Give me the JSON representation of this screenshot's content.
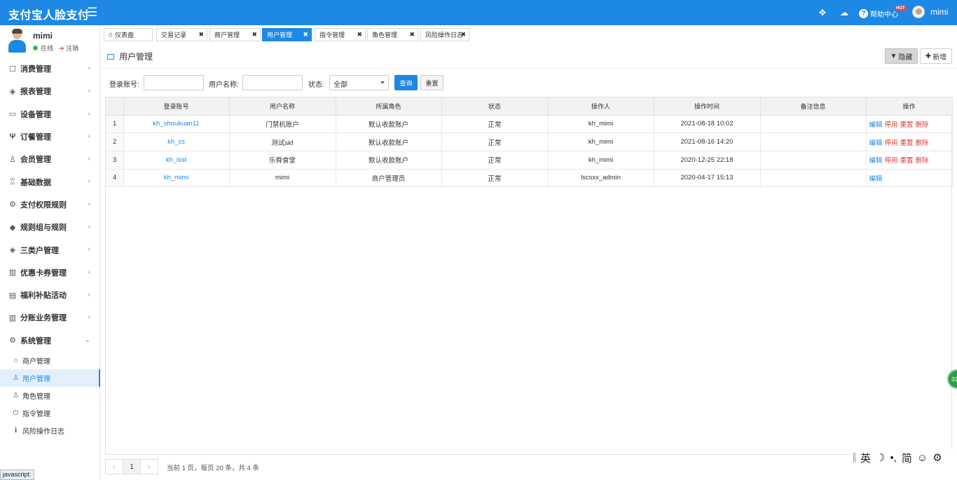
{
  "header": {
    "app_title": "支付宝人脸支付",
    "help_label": "帮助中心",
    "hot_badge": "HOT",
    "user_name": "mimi"
  },
  "profile": {
    "name": "mimi",
    "status": "在线",
    "logout": "注销"
  },
  "sidebar": {
    "items": [
      {
        "label": "消费管理",
        "icon": "calendar-icon"
      },
      {
        "label": "报表管理",
        "icon": "layers-icon"
      },
      {
        "label": "设备管理",
        "icon": "monitor-icon"
      },
      {
        "label": "订餐管理",
        "icon": "utensils-icon"
      },
      {
        "label": "会员管理",
        "icon": "user-icon"
      },
      {
        "label": "基础数据",
        "icon": "sitemap-icon"
      },
      {
        "label": "支付权限规则",
        "icon": "settings-icon"
      },
      {
        "label": "规则组与规则",
        "icon": "tag-icon"
      },
      {
        "label": "三类户管理",
        "icon": "layers-icon"
      },
      {
        "label": "优惠卡券管理",
        "icon": "barcode-icon"
      },
      {
        "label": "福利补贴活动",
        "icon": "gift-icon"
      },
      {
        "label": "分账业务管理",
        "icon": "bank-icon"
      },
      {
        "label": "系统管理",
        "icon": "settings-icon"
      }
    ],
    "subitems": [
      {
        "label": "商户管理",
        "icon": "home-icon"
      },
      {
        "label": "用户管理",
        "icon": "user-icon"
      },
      {
        "label": "角色管理",
        "icon": "user-icon"
      },
      {
        "label": "指令管理",
        "icon": "power-icon"
      },
      {
        "label": "风险操作日志",
        "icon": "info-icon"
      }
    ]
  },
  "tabs": [
    {
      "label": "仪表盘"
    },
    {
      "label": "交易记录"
    },
    {
      "label": "商户管理"
    },
    {
      "label": "用户管理"
    },
    {
      "label": "指令管理"
    },
    {
      "label": "角色管理"
    },
    {
      "label": "风险操作日志"
    }
  ],
  "panel": {
    "title": "用户管理",
    "hide_button": "隐藏",
    "add_button": "新增"
  },
  "search": {
    "account_label": "登录账号:",
    "account_value": "",
    "username_label": "用户名称:",
    "username_value": "",
    "status_label": "状态:",
    "status_value": "全部",
    "query_button": "查询",
    "reset_button": "重置"
  },
  "table": {
    "headers": [
      "",
      "登录账号",
      "用户名称",
      "所属角色",
      "状态",
      "操作人",
      "操作时间",
      "备注信息",
      "操作"
    ],
    "rows": [
      {
        "no": "1",
        "account": "kh_shoukuan11",
        "name": "门禁机账户",
        "role": "默认收款账户",
        "status": "正常",
        "operator": "kh_mimi",
        "time": "2021-08-18 10:02",
        "note": "",
        "ops": [
          "编辑",
          "停用",
          "重置",
          "删除"
        ]
      },
      {
        "no": "2",
        "account": "kh_cs",
        "name": "测试skf",
        "role": "默认收款账户",
        "status": "正常",
        "operator": "kh_mimi",
        "time": "2021-08-16 14:20",
        "note": "",
        "ops": [
          "编辑",
          "停用",
          "重置",
          "删除"
        ]
      },
      {
        "no": "3",
        "account": "kh_lsst",
        "name": "乐舜食堂",
        "role": "默认收款账户",
        "status": "正常",
        "operator": "kh_mimi",
        "time": "2020-12-25 22:18",
        "note": "",
        "ops": [
          "编辑",
          "停用",
          "重置",
          "删除"
        ]
      },
      {
        "no": "4",
        "account": "kh_mimi",
        "name": "mimi",
        "role": "商户管理员",
        "status": "正常",
        "operator": "lscsxx_admin",
        "time": "2020-04-17 15:13",
        "note": "",
        "ops": [
          "编辑"
        ]
      }
    ]
  },
  "pager": {
    "prev": "‹",
    "current": "1",
    "next": "›",
    "info": "当前 1 页，每页 20 条，共 4 条"
  },
  "ime": {
    "lang": "英",
    "moon": "☽",
    "punct": "•,",
    "simp": "简",
    "smile": "☺",
    "gear": "⚙"
  },
  "float_ball": "32",
  "status_bar": "javascript:"
}
